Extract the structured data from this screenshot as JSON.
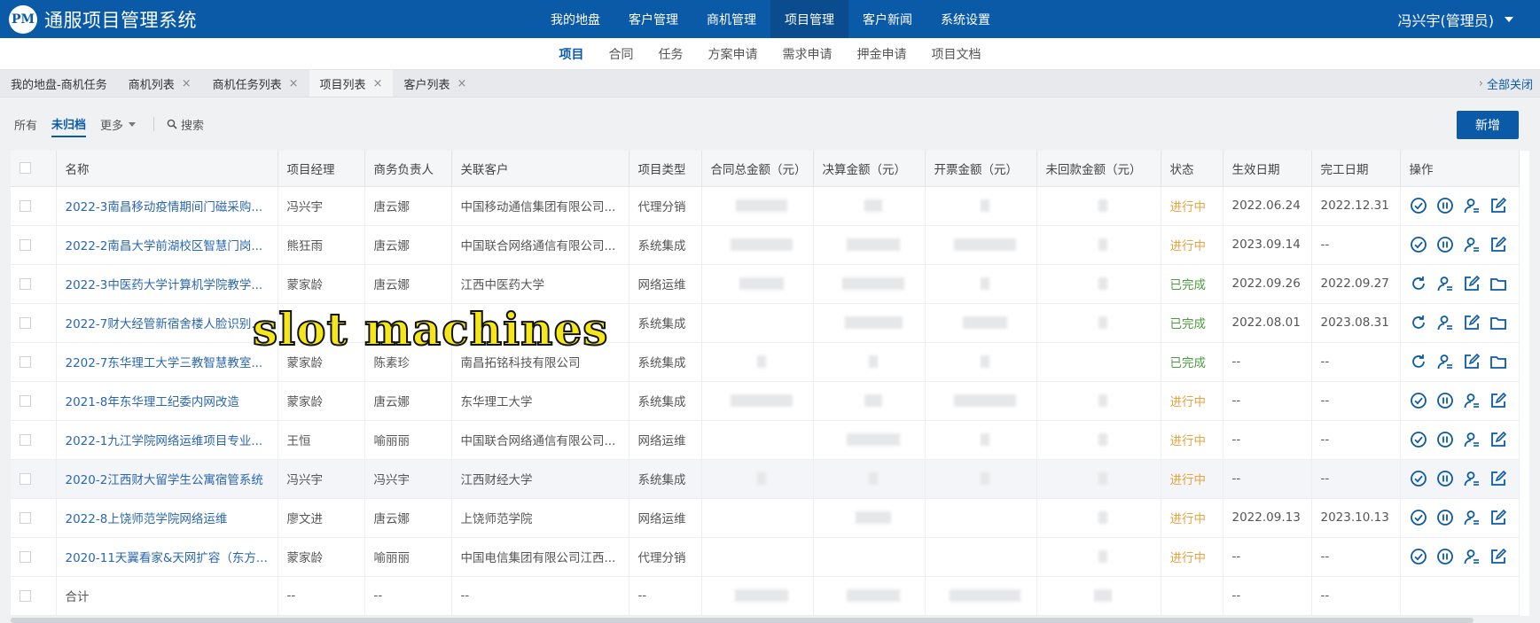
{
  "app": {
    "logo_text": "PM",
    "title": "通服项目管理系统"
  },
  "topnav": [
    {
      "label": "我的地盘",
      "active": false
    },
    {
      "label": "客户管理",
      "active": false
    },
    {
      "label": "商机管理",
      "active": false
    },
    {
      "label": "项目管理",
      "active": true
    },
    {
      "label": "客户新闻",
      "active": false
    },
    {
      "label": "系统设置",
      "active": false
    }
  ],
  "user": {
    "label": "冯兴宇(管理员)"
  },
  "subnav": [
    {
      "label": "项目",
      "active": true
    },
    {
      "label": "合同",
      "active": false
    },
    {
      "label": "任务",
      "active": false
    },
    {
      "label": "方案申请",
      "active": false
    },
    {
      "label": "需求申请",
      "active": false
    },
    {
      "label": "押金申请",
      "active": false
    },
    {
      "label": "项目文档",
      "active": false
    }
  ],
  "tabs": [
    {
      "label": "我的地盘-商机任务",
      "closable": false,
      "active": false
    },
    {
      "label": "商机列表",
      "closable": true,
      "active": false
    },
    {
      "label": "商机任务列表",
      "closable": true,
      "active": false
    },
    {
      "label": "项目列表",
      "closable": true,
      "active": true
    },
    {
      "label": "客户列表",
      "closable": true,
      "active": false
    }
  ],
  "close_all": "全部关闭",
  "filters": {
    "all": "所有",
    "unarchived": "未归档",
    "more": "更多",
    "search": "搜索"
  },
  "add_button": "新增",
  "columns": [
    "名称",
    "项目经理",
    "商务负责人",
    "关联客户",
    "项目类型",
    "合同总金额（元）",
    "决算金额（元）",
    "开票金额（元）",
    "未回款金额（元）",
    "状态",
    "生效日期",
    "完工日期",
    "操作"
  ],
  "rows": [
    {
      "name": "2022-3南昌移动疫情期间门磁采购...",
      "pm": "冯兴宇",
      "biz": "唐云娜",
      "client": "中国移动通信集团有限公司...",
      "type": "代理分销",
      "status": "进行中",
      "status_kind": "run",
      "start": "2022.06.24",
      "end": "2022.12.31",
      "ops": [
        "check-circle-icon",
        "pause-circle-icon",
        "user-assign-icon",
        "edit-icon"
      ]
    },
    {
      "name": "2022-2南昌大学前湖校区智慧门岗...",
      "pm": "熊狂雨",
      "biz": "唐云娜",
      "client": "中国联合网络通信有限公司...",
      "type": "系统集成",
      "status": "进行中",
      "status_kind": "run",
      "start": "2023.09.14",
      "end": "--",
      "ops": [
        "check-circle-icon",
        "pause-circle-icon",
        "user-assign-icon",
        "edit-icon"
      ]
    },
    {
      "name": "2022-3中医药大学计算机学院教学...",
      "pm": "蒙家龄",
      "biz": "唐云娜",
      "client": "江西中医药大学",
      "type": "网络运维",
      "status": "已完成",
      "status_kind": "done",
      "start": "2022.09.26",
      "end": "2022.09.27",
      "ops": [
        "refresh-icon",
        "user-assign-icon",
        "edit-icon",
        "folder-icon"
      ]
    },
    {
      "name": "2022-7财大经管新宿舍楼人脸识别...",
      "pm": "",
      "biz": "",
      "client": "",
      "type": "系统集成",
      "status": "已完成",
      "status_kind": "done",
      "start": "2022.08.01",
      "end": "2023.08.31",
      "ops": [
        "refresh-icon",
        "user-assign-icon",
        "edit-icon",
        "folder-icon"
      ]
    },
    {
      "name": "2202-7东华理工大学三教智慧教室...",
      "pm": "蒙家龄",
      "biz": "陈素珍",
      "client": "南昌拓铭科技有限公司",
      "type": "系统集成",
      "status": "已完成",
      "status_kind": "done",
      "start": "--",
      "end": "--",
      "ops": [
        "refresh-icon",
        "user-assign-icon",
        "edit-icon",
        "folder-icon"
      ]
    },
    {
      "name": "2021-8年东华理工纪委内网改造",
      "pm": "蒙家龄",
      "biz": "唐云娜",
      "client": "东华理工大学",
      "type": "系统集成",
      "status": "进行中",
      "status_kind": "run",
      "start": "--",
      "end": "--",
      "ops": [
        "check-circle-icon",
        "pause-circle-icon",
        "user-assign-icon",
        "edit-icon"
      ]
    },
    {
      "name": "2022-1九江学院网络运维项目专业...",
      "pm": "王恒",
      "biz": "喻丽丽",
      "client": "中国联合网络通信有限公司...",
      "type": "网络运维",
      "status": "进行中",
      "status_kind": "run",
      "start": "--",
      "end": "--",
      "ops": [
        "check-circle-icon",
        "pause-circle-icon",
        "user-assign-icon",
        "edit-icon"
      ]
    },
    {
      "name": "2020-2江西财大留学生公寓宿管系统",
      "pm": "冯兴宇",
      "biz": "冯兴宇",
      "client": "江西财经大学",
      "type": "系统集成",
      "status": "进行中",
      "status_kind": "run",
      "start": "--",
      "end": "--",
      "ops": [
        "check-circle-icon",
        "pause-circle-icon",
        "user-assign-icon",
        "edit-icon"
      ]
    },
    {
      "name": "2022-8上饶师范学院网络运维",
      "pm": "廖文进",
      "biz": "唐云娜",
      "client": "上饶师范学院",
      "type": "网络运维",
      "status": "进行中",
      "status_kind": "run",
      "start": "2022.09.13",
      "end": "2023.10.13",
      "ops": [
        "check-circle-icon",
        "pause-circle-icon",
        "user-assign-icon",
        "edit-icon"
      ]
    },
    {
      "name": "2020-11天翼看家&天网扩容（东方...",
      "pm": "蒙家龄",
      "biz": "喻丽丽",
      "client": "中国电信集团有限公司江西...",
      "type": "代理分销",
      "status": "进行中",
      "status_kind": "run",
      "start": "--",
      "end": "--",
      "ops": [
        "check-circle-icon",
        "pause-circle-icon",
        "user-assign-icon",
        "edit-icon"
      ]
    }
  ],
  "total_row": {
    "label": "合计",
    "pm": "--",
    "biz": "--",
    "client": "--",
    "type": "--",
    "start": "--",
    "end": "--"
  },
  "overlay_text": "slot machines",
  "colors": {
    "primary": "#0a5aa8",
    "running": "#e8a33c",
    "done": "#4a9c3c"
  }
}
